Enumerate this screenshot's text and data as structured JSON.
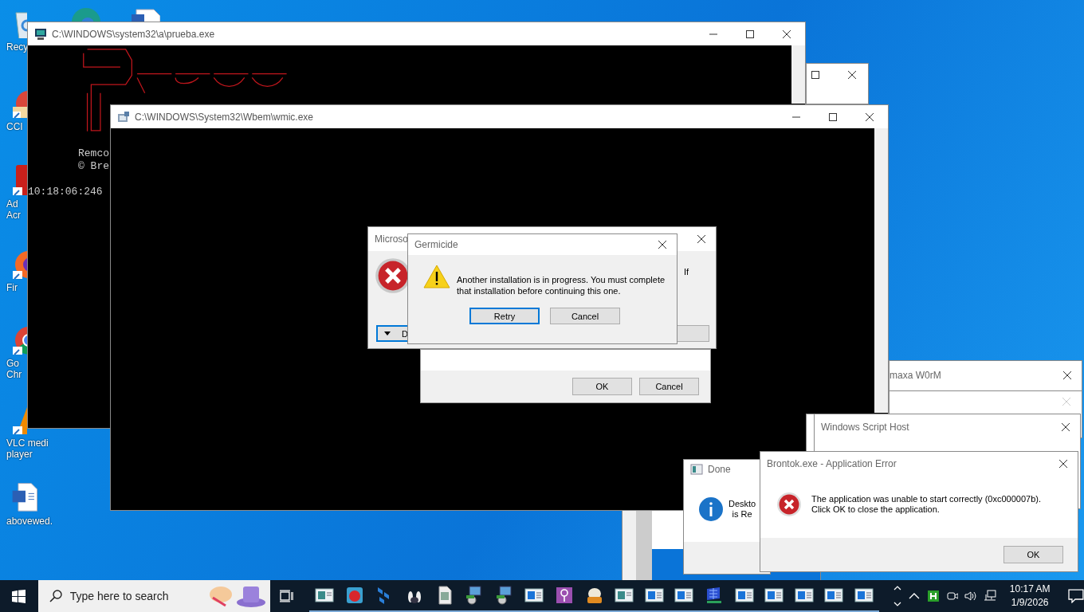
{
  "desktop_icons": [
    {
      "label": "Recy",
      "kind": "recycle"
    },
    {
      "label": "CCI",
      "kind": "ccleaner"
    },
    {
      "label": "Ad\nAcr",
      "kind": "acrobat"
    },
    {
      "label": "Fir",
      "kind": "firefox"
    },
    {
      "label": "Go\nChr",
      "kind": "chrome"
    },
    {
      "label": "VLC medi\nplayer",
      "kind": "vlc"
    },
    {
      "label": "abovewed.",
      "kind": "word"
    }
  ],
  "console_window": {
    "title": "C:\\WINDOWS\\system32\\a\\prueba.exe",
    "lines": [
      "Remco",
      "© Bre"
    ],
    "timestamp": "10:18:06:246"
  },
  "wmic_window": {
    "title": "C:\\WINDOWS\\System32\\Wbem\\wmic.exe"
  },
  "error_dialog": {
    "title": "Microso",
    "message_fragment": "If",
    "details_button": "D"
  },
  "confirm_dialog": {
    "buttons": [
      {
        "label": "OK",
        "focused": false
      },
      {
        "label": "Cancel",
        "focused": false
      }
    ]
  },
  "germicide_dialog": {
    "title": "Germicide",
    "message": "Another installation is in progress. You must complete that installation before continuing this one.",
    "buttons": [
      {
        "label": "Retry",
        "focused": true
      },
      {
        "label": "Cancel",
        "focused": false
      }
    ]
  },
  "worm_window": {
    "title": "maxa W0rM"
  },
  "script_host_window": {
    "title": "Windows Script Host"
  },
  "done_dialog": {
    "title": "Done",
    "message_lines": [
      "Deskto",
      "is Re"
    ]
  },
  "app_error_dialog": {
    "title": "Brontok.exe - Application Error",
    "message": "The application was unable to start correctly (0xc000007b). Click OK to close the application.",
    "button": "OK"
  },
  "taskbar": {
    "search_placeholder": "Type here to search",
    "apps": [
      {
        "kind": "viewer"
      },
      {
        "kind": "bird"
      },
      {
        "kind": "tiles"
      },
      {
        "kind": "pins"
      },
      {
        "kind": "doc"
      },
      {
        "kind": "setup"
      },
      {
        "kind": "setup"
      },
      {
        "kind": "window"
      },
      {
        "kind": "key"
      },
      {
        "kind": "exe"
      },
      {
        "kind": "viewer"
      },
      {
        "kind": "window"
      },
      {
        "kind": "window"
      },
      {
        "kind": "network"
      },
      {
        "kind": "window"
      },
      {
        "kind": "window"
      },
      {
        "kind": "window"
      },
      {
        "kind": "window"
      },
      {
        "kind": "window"
      }
    ],
    "time": "10:17 AM",
    "date": "1/9/2026"
  }
}
